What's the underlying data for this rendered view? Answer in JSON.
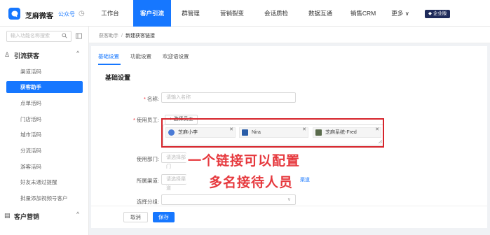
{
  "header": {
    "brand": "芝麻微客",
    "brand_sub": "公众号",
    "brand_icon": "clock-icon",
    "nav": [
      "工作台",
      "客户引流",
      "群管理",
      "营销裂变",
      "会话质检",
      "数据互通",
      "销售CRM",
      "更多 ∨"
    ],
    "active_nav": "客户引流",
    "enterprise_badge": "企业版"
  },
  "sidebar": {
    "search_placeholder": "输入功能名称搜索",
    "group1": {
      "icon": "users-icon",
      "label": "引流获客",
      "chevron": "^"
    },
    "items": [
      "渠道活码",
      "获客助手",
      "点单活码",
      "门店活码",
      "城市活码",
      "分流活码",
      "游客活码",
      "好友未通过提醒",
      "批量添加视频号客户"
    ],
    "active_item": "获客助手",
    "group2": {
      "icon": "document-icon",
      "label": "客户营销",
      "chevron": "^"
    }
  },
  "breadcrumb": {
    "parent": "获客助手",
    "separator": "/",
    "current": "新建获客链接"
  },
  "tabs": [
    "基础设置",
    "功能设置",
    "欢迎语设置"
  ],
  "section_title": "基础设置",
  "form": {
    "name_label": "名称:",
    "name_placeholder": "请输入名称",
    "staff_label": "使用员工:",
    "select_staff_button": "+ 选择员工",
    "staff_chips": [
      {
        "name": "芝麻小李",
        "avatar_color": "#4a7bd6"
      },
      {
        "name": "Nira",
        "avatar_color": "#2a5da8"
      },
      {
        "name": "芝麻系统-Fred",
        "avatar_color": "#5a6b4c"
      }
    ],
    "dept_label": "使用部门:",
    "dept_placeholder": "请选择部门",
    "channel_label": "所属渠道:",
    "channel_placeholder": "请选择渠道",
    "channel_link": "渠道",
    "group_label": "选择分组:"
  },
  "annotation": {
    "line1": "一个链接可以配置",
    "line2": "多名接待人员",
    "color": "#e6393e"
  },
  "footer": {
    "cancel": "取消",
    "save": "保存"
  },
  "colors": {
    "primary": "#1677ff",
    "highlight_border": "#d6242b"
  }
}
